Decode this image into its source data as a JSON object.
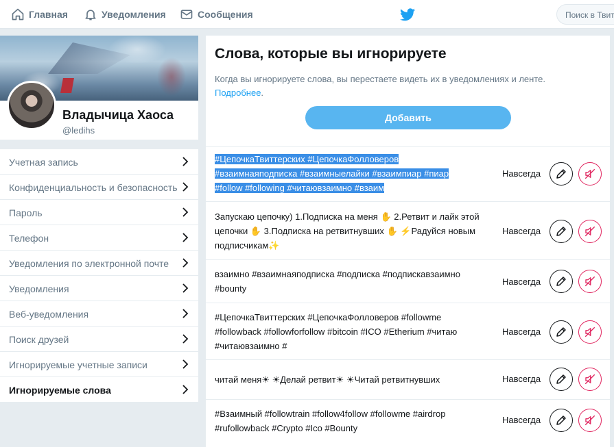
{
  "nav": {
    "home": "Главная",
    "notifications": "Уведомления",
    "messages": "Сообщения",
    "search_placeholder": "Поиск в Твиттере"
  },
  "profile": {
    "name": "Владычица Хаоса",
    "handle": "@ledihs"
  },
  "menu": {
    "items": [
      {
        "label": "Учетная запись",
        "active": false
      },
      {
        "label": "Конфиденциальность и безопасность",
        "active": false
      },
      {
        "label": "Пароль",
        "active": false
      },
      {
        "label": "Телефон",
        "active": false
      },
      {
        "label": "Уведомления по электронной почте",
        "active": false
      },
      {
        "label": "Уведомления",
        "active": false
      },
      {
        "label": "Веб-уведомления",
        "active": false
      },
      {
        "label": "Поиск друзей",
        "active": false
      },
      {
        "label": "Игнорируемые учетные записи",
        "active": false
      },
      {
        "label": "Игнорируемые слова",
        "active": true
      }
    ]
  },
  "main": {
    "title": "Слова, которые вы игнорируете",
    "description": "Когда вы игнорируете слова, вы перестаете видеть их в уведомлениях и ленте.",
    "learn_more": "Подробнее",
    "add_button": "Добавить"
  },
  "muted": [
    {
      "lines": [
        "#ЦепочкаТвиттерских #ЦепочкаФолловеров",
        "#взаимнаяподписка #взаимныелайки #взаимпиар #пиар",
        "#follow #following #читаювзаимно #взаим"
      ],
      "duration": "Навсегда",
      "selected": true
    },
    {
      "lines": [
        "Запускаю цепочку) 1.Подписка на меня ✋ 2.Ретвит и лайк этой",
        "цепочки ✋ 3.Подписка на ретвитнувших ✋ ⚡Радуйся новым",
        "подписчикам✨"
      ],
      "duration": "Навсегда",
      "selected": false
    },
    {
      "lines": [
        "взаимно #взаимнаяподписка #подписка #подпискавзаимно",
        "#bounty"
      ],
      "duration": "Навсегда",
      "selected": false
    },
    {
      "lines": [
        "#ЦепочкаТвиттерских #ЦепочкаФолловеров #followme",
        "#followback #followforfollow #bitcoin #ICO #Etherium #читаю",
        "#читаювзаимно #"
      ],
      "duration": "Навсегда",
      "selected": false
    },
    {
      "lines": [
        "читай меня☀ ☀Делай ретвит☀ ☀Читай ретвитнувших"
      ],
      "duration": "Навсегда",
      "selected": false
    },
    {
      "lines": [
        "#Взаимный #followtrain #follow4follow #followme #airdrop",
        "#rufollowback #Crypto #Ico #Bounty"
      ],
      "duration": "Навсегда",
      "selected": false
    }
  ],
  "colors": {
    "accent": "#1da1f2",
    "mute_red": "#e0245e",
    "selection": "#3a8ee6"
  }
}
